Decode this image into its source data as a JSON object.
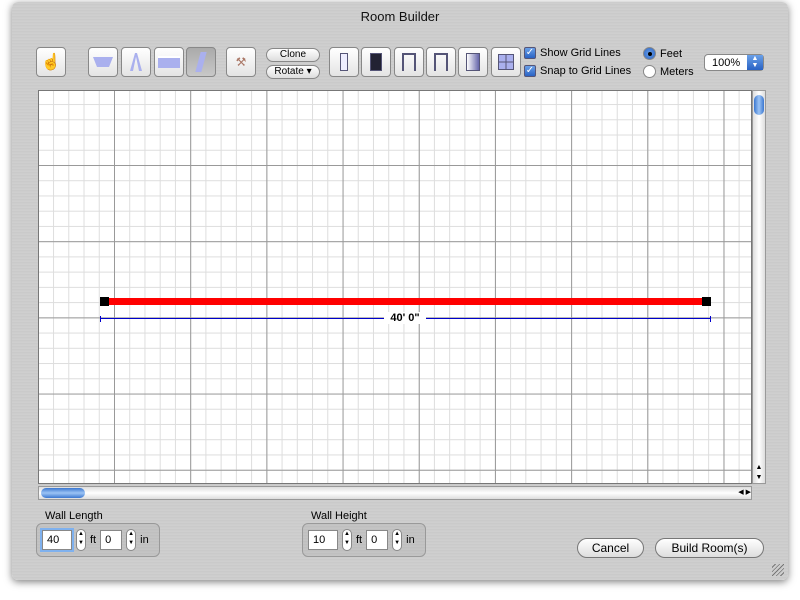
{
  "window": {
    "title": "Room Builder"
  },
  "toolbar": {
    "clone_label": "Clone",
    "rotate_label": "Rotate ▾",
    "tools": [
      "hand-tool",
      "room-tool",
      "angled-walls-tool",
      "parallel-walls-tool",
      "single-wall-tool",
      "demolish-tool"
    ],
    "openings": [
      "door-tool",
      "double-door-tool",
      "opening-tool",
      "double-opening-tool",
      "arch-tool",
      "window-tool"
    ]
  },
  "options": {
    "show_grid_label": "Show Grid Lines",
    "show_grid_checked": true,
    "snap_grid_label": "Snap to Grid Lines",
    "snap_grid_checked": true,
    "feet_label": "Feet",
    "meters_label": "Meters",
    "units_selected": "Feet",
    "zoom_value": "100%"
  },
  "canvas": {
    "dimension_label": "40' 0\"",
    "wall_color": "#ff0000",
    "dimension_color": "#0000cc"
  },
  "wall_length": {
    "label": "Wall Length",
    "ft": "40",
    "ft_unit": "ft",
    "in": "0",
    "in_unit": "in"
  },
  "wall_height": {
    "label": "Wall Height",
    "ft": "10",
    "ft_unit": "ft",
    "in": "0",
    "in_unit": "in"
  },
  "buttons": {
    "cancel": "Cancel",
    "build": "Build Room(s)"
  }
}
